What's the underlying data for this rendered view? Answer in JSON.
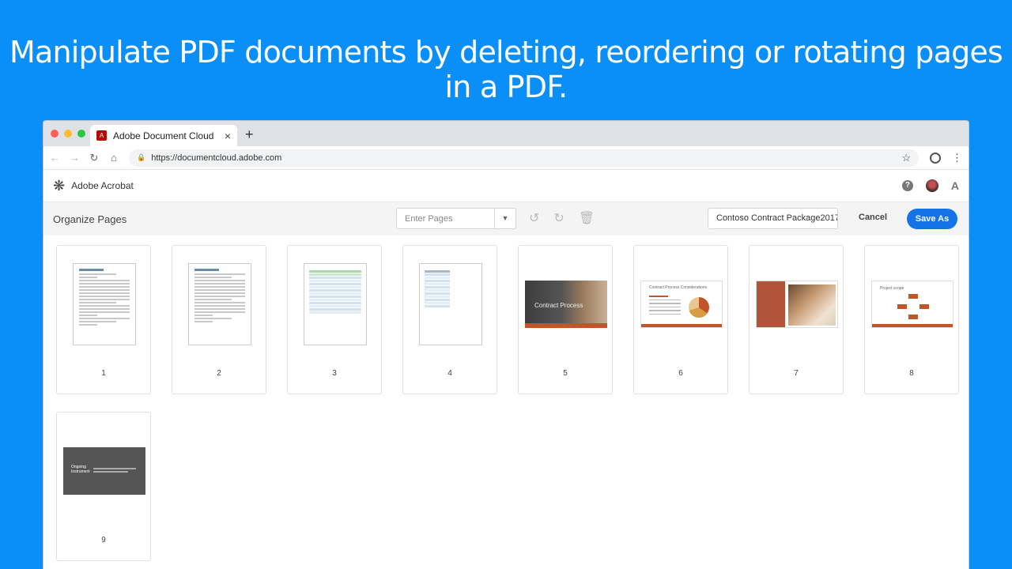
{
  "headline": "Manipulate PDF documents by deleting, reordering or rotating pages in a PDF.",
  "browser": {
    "tab_title": "Adobe Document Cloud",
    "tab_close": "×",
    "new_tab": "+",
    "url": "https://documentcloud.adobe.com",
    "icons": [
      "back-icon",
      "forward-icon",
      "reload-icon",
      "home-icon",
      "lock-icon",
      "star-icon",
      "profile-icon",
      "menu-icon"
    ]
  },
  "app": {
    "name": "Adobe Acrobat",
    "icons": [
      "acrobat-logo-icon",
      "help-icon",
      "avatar",
      "adobe-logo-icon"
    ]
  },
  "toolbar": {
    "title": "Organize Pages",
    "pages_placeholder": "Enter Pages",
    "filename": "Contoso Contract  Package2017-",
    "cancel_label": "Cancel",
    "save_label": "Save As"
  },
  "pages": [
    {
      "number": "1"
    },
    {
      "number": "2"
    },
    {
      "number": "3"
    },
    {
      "number": "4"
    },
    {
      "number": "5"
    },
    {
      "number": "6"
    },
    {
      "number": "7"
    },
    {
      "number": "8"
    },
    {
      "number": "9"
    }
  ],
  "thumb_text": {
    "p5": "Contract Process",
    "p6": "Contract Process Considerations",
    "p8": "Project scope",
    "p9": "Ongoing Instrument"
  },
  "colors": {
    "background": "#0a8ef7",
    "save_button": "#1473e6",
    "accent_orange": "#c0552b"
  }
}
